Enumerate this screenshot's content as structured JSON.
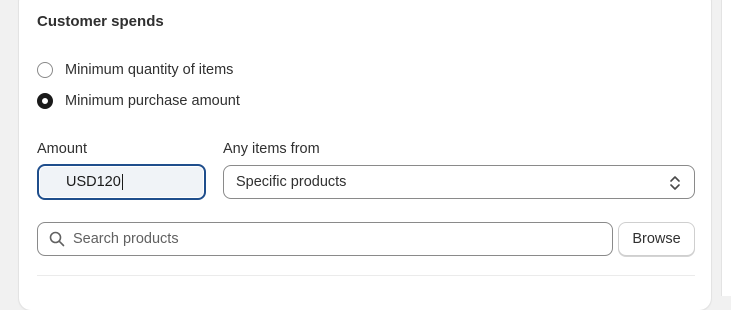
{
  "section": {
    "title": "Customer spends"
  },
  "options": [
    {
      "label": "Minimum quantity of items",
      "selected": false
    },
    {
      "label": "Minimum purchase amount",
      "selected": true
    }
  ],
  "amount": {
    "label": "Amount",
    "value": "USD120"
  },
  "items_from": {
    "label": "Any items from",
    "selected": "Specific products"
  },
  "search": {
    "placeholder": "Search products"
  },
  "browse_label": "Browse",
  "icons": {
    "search": "search-icon",
    "select": "chevron-up-down-icon"
  },
  "colors": {
    "focus_border": "#1f4e8c",
    "radio_selected": "#1a1a1a"
  }
}
